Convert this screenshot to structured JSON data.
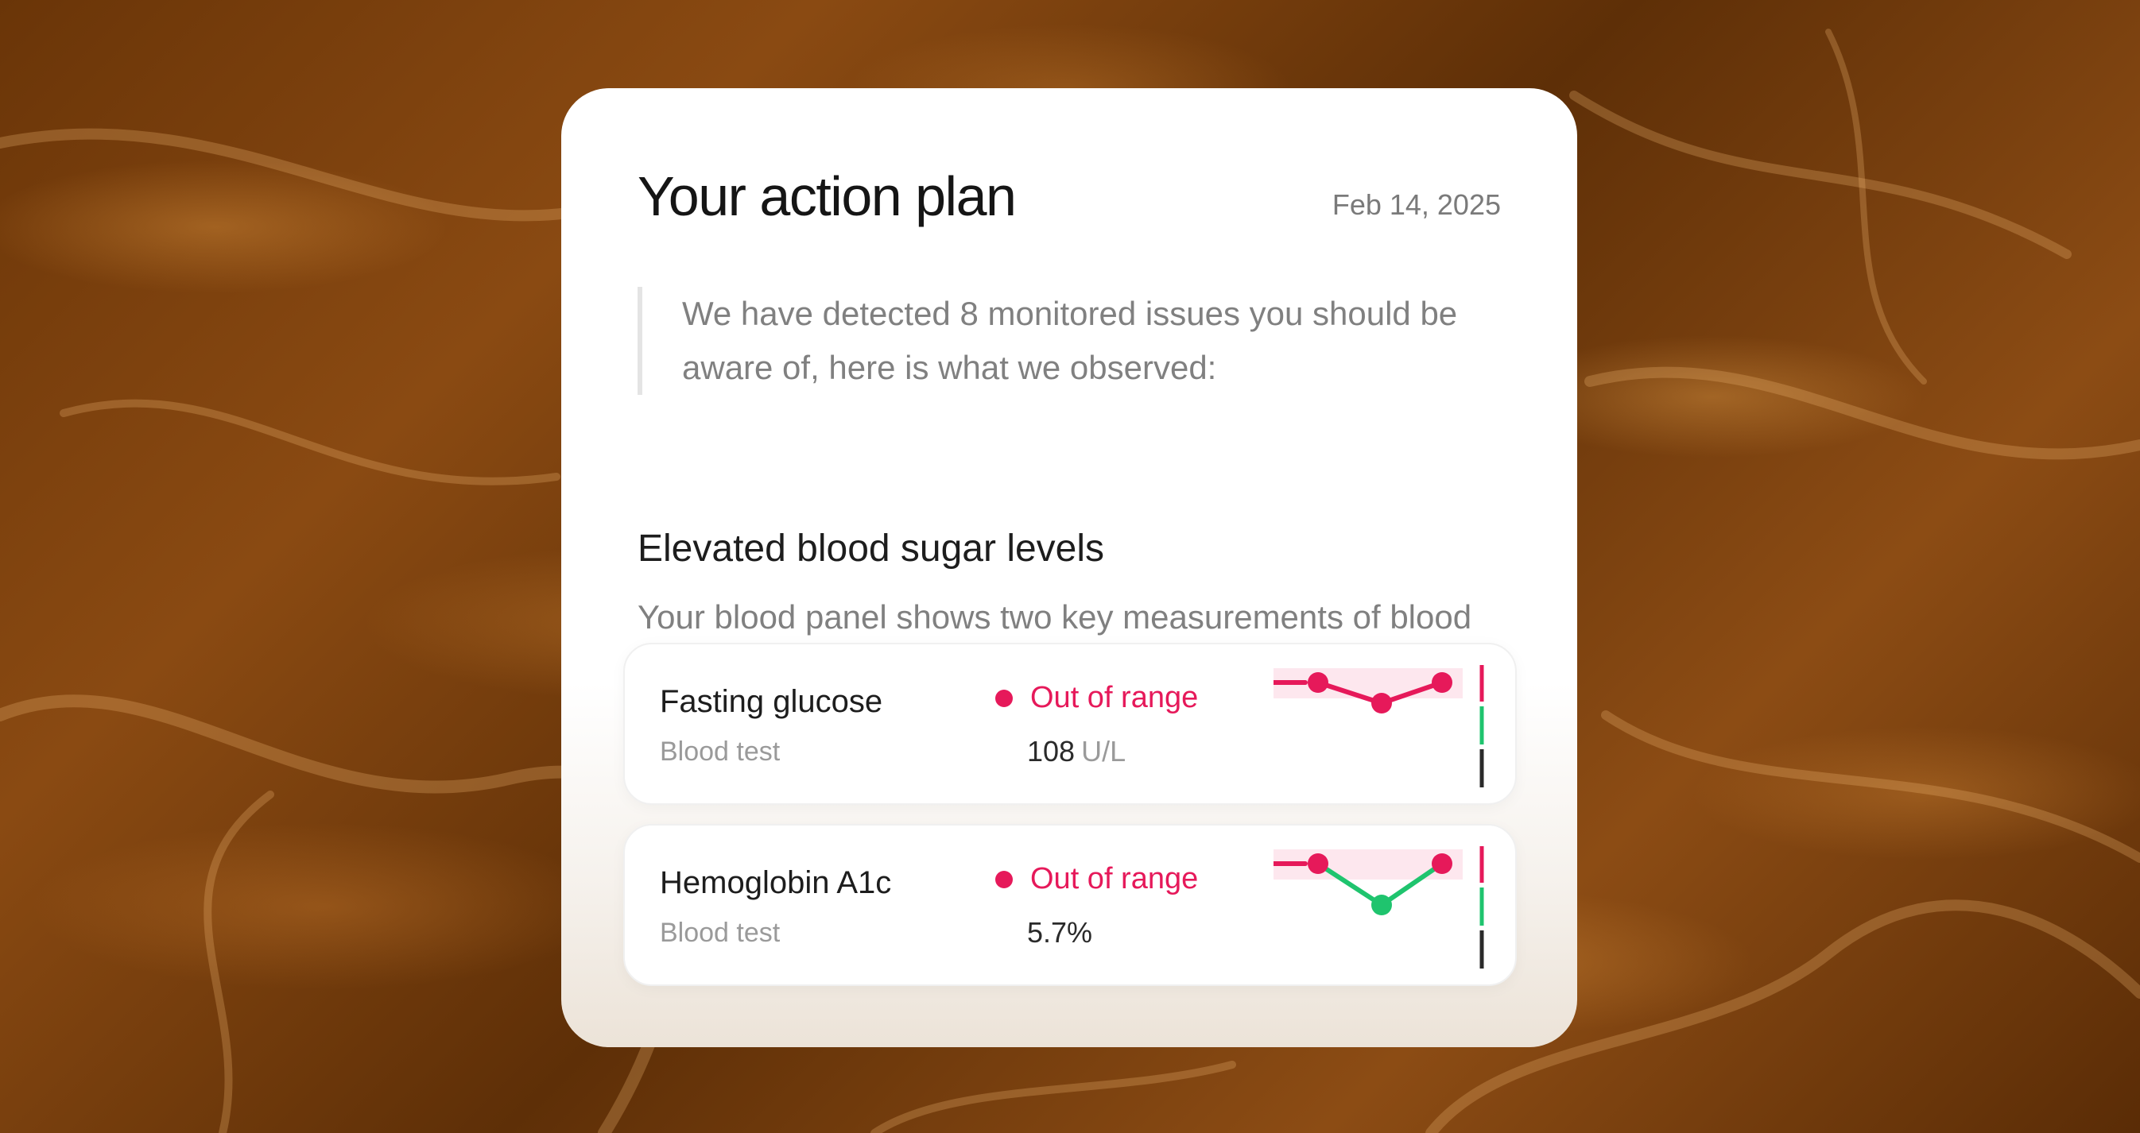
{
  "card": {
    "title": "Your action plan",
    "date": "Feb 14, 2025",
    "intro": "We have detected 8 monitored issues you should be aware of, here is what we observed:"
  },
  "section": {
    "title": "Elevated blood sugar levels",
    "description": "Your blood panel shows two key measurements of blood sugar that are above optimal ranges:"
  },
  "metrics": [
    {
      "name": "Fasting glucose",
      "source": "Blood test",
      "status": "Out of range",
      "value": "108",
      "unit": "U/L",
      "trend_points": [
        {
          "status": "out-of-range"
        },
        {
          "status": "out-of-range"
        },
        {
          "status": "out-of-range"
        }
      ]
    },
    {
      "name": "Hemoglobin A1c",
      "source": "Blood test",
      "status": "Out of range",
      "value": "5.7%",
      "unit": "",
      "trend_points": [
        {
          "status": "out-of-range"
        },
        {
          "status": "in-range"
        },
        {
          "status": "out-of-range"
        }
      ]
    }
  ],
  "colors": {
    "out_of_range": "#e6195a",
    "in_range": "#1fc46e",
    "baseline": "#2a2a2a",
    "band": "#fde7ee"
  },
  "icons": [
    "status-dot-icon",
    "sparkline-chart"
  ]
}
